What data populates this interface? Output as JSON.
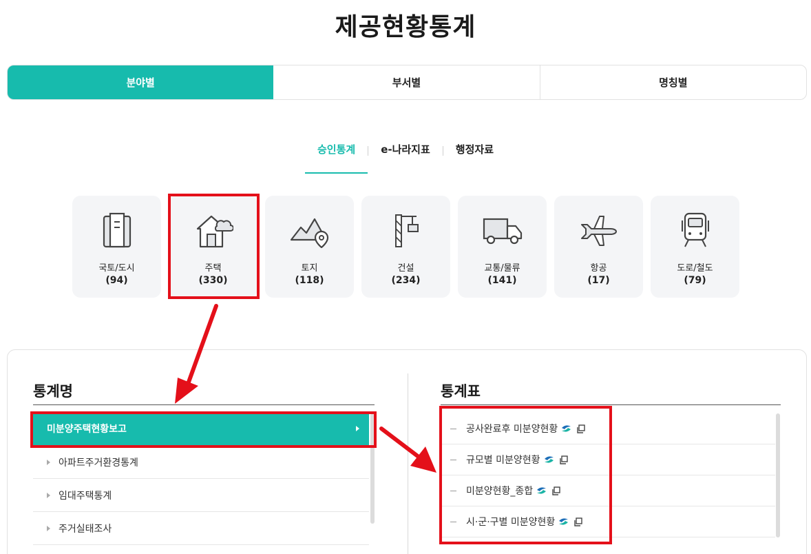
{
  "page": {
    "title": "제공현황통계"
  },
  "main_tabs": [
    {
      "label": "분야별",
      "active": true
    },
    {
      "label": "부서별",
      "active": false
    },
    {
      "label": "명칭별",
      "active": false
    }
  ],
  "sub_tabs": [
    {
      "label": "승인통계",
      "active": true
    },
    {
      "label": "e-나라지표",
      "active": false
    },
    {
      "label": "행정자료",
      "active": false
    }
  ],
  "categories": [
    {
      "label": "국토/도시",
      "count": "(94)",
      "icon": "building-icon"
    },
    {
      "label": "주택",
      "count": "(330)",
      "icon": "house-icon"
    },
    {
      "label": "토지",
      "count": "(118)",
      "icon": "land-pin-icon"
    },
    {
      "label": "건설",
      "count": "(234)",
      "icon": "crane-icon"
    },
    {
      "label": "교통/물류",
      "count": "(141)",
      "icon": "truck-icon"
    },
    {
      "label": "항공",
      "count": "(17)",
      "icon": "airplane-icon"
    },
    {
      "label": "도로/철도",
      "count": "(79)",
      "icon": "train-icon"
    }
  ],
  "stat_names": {
    "title": "통계명",
    "items": [
      {
        "label": "미분양주택현황보고",
        "active": true
      },
      {
        "label": "아파트주거환경통계",
        "active": false
      },
      {
        "label": "임대주택통계",
        "active": false
      },
      {
        "label": "주거실태조사",
        "active": false
      }
    ]
  },
  "stat_tables": {
    "title": "통계표",
    "items": [
      {
        "label": "공사완료후 미분양현황"
      },
      {
        "label": "규모별 미분양현황"
      },
      {
        "label": "미분양현황_종합"
      },
      {
        "label": "시·군·구별 미분양현황"
      }
    ]
  },
  "colors": {
    "accent": "#17bbad",
    "highlight": "#e4101a",
    "card_bg": "#f4f5f7"
  }
}
